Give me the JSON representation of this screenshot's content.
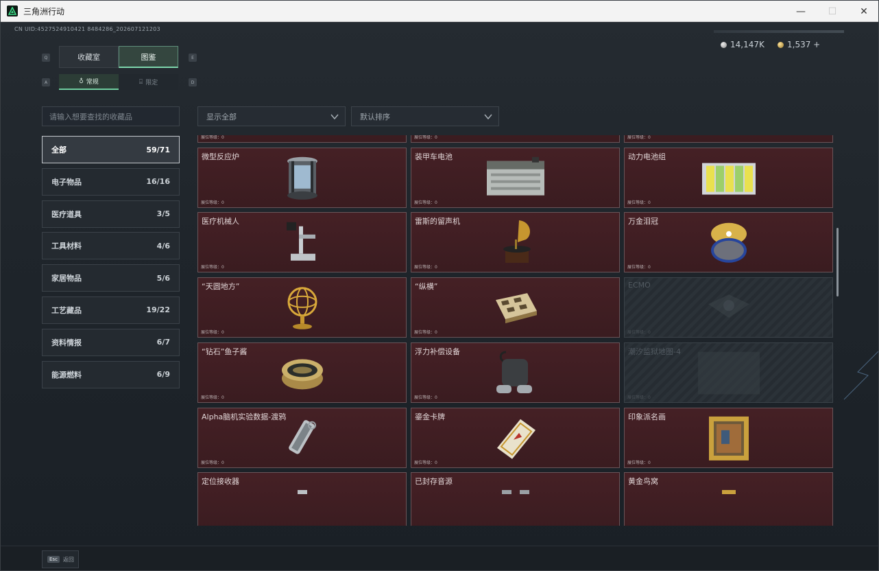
{
  "window": {
    "title": "三角洲行动",
    "minimize": "—",
    "maximize": "☐",
    "close": "✕"
  },
  "uid": "CN UID:4527524910421 8484286_202607121203",
  "currency": [
    {
      "value": "14,147K",
      "color": "#c8c8c8"
    },
    {
      "value": "1,537 +",
      "color": "#d4b35a"
    }
  ],
  "tabs": [
    {
      "label": "收藏室"
    },
    {
      "label": "图鉴"
    }
  ],
  "tab_hints": {
    "left": "Q",
    "right": "E"
  },
  "subtabs": [
    {
      "label": "常规"
    },
    {
      "label": "限定"
    }
  ],
  "subtab_hints": {
    "left": "A",
    "right": "D"
  },
  "search": {
    "placeholder": "请输入想要查找的收藏品"
  },
  "filter": {
    "value": "显示全部"
  },
  "sort": {
    "value": "默认排序"
  },
  "categories": [
    {
      "name": "全部",
      "count": "59/71"
    },
    {
      "name": "电子物品",
      "count": "16/16"
    },
    {
      "name": "医疗道具",
      "count": "3/5"
    },
    {
      "name": "工具材料",
      "count": "4/6"
    },
    {
      "name": "家居物品",
      "count": "5/6"
    },
    {
      "name": "工艺藏品",
      "count": "19/22"
    },
    {
      "name": "资料情报",
      "count": "6/7"
    },
    {
      "name": "能源燃料",
      "count": "6/9"
    }
  ],
  "cards": [
    {
      "name": "",
      "level": "展位等级：0",
      "art": "camera",
      "locked": false
    },
    {
      "name": "",
      "level": "展位等级：0",
      "art": "robot-vacuum",
      "locked": false
    },
    {
      "name": "",
      "level": "展位等级：0",
      "art": "coffee-bag",
      "locked": false
    },
    {
      "name": "微型反应炉",
      "level": "展位等级：0",
      "art": "reactor",
      "locked": false
    },
    {
      "name": "装甲车电池",
      "level": "展位等级：0",
      "art": "battery",
      "locked": false
    },
    {
      "name": "动力电池组",
      "level": "展位等级：0",
      "art": "battery-pack",
      "locked": false
    },
    {
      "name": "医疗机械人",
      "level": "展位等级：0",
      "art": "medical-robot",
      "locked": false
    },
    {
      "name": "雷斯的留声机",
      "level": "展位等级：0",
      "art": "gramophone",
      "locked": false
    },
    {
      "name": "万金泪冠",
      "level": "展位等级：0",
      "art": "egg",
      "locked": false
    },
    {
      "name": "“天圆地方”",
      "level": "展位等级：0",
      "art": "armillary",
      "locked": false
    },
    {
      "name": "“纵横”",
      "level": "展位等级：0",
      "art": "chess",
      "locked": false
    },
    {
      "name": "ECMO",
      "level": "展位等级：0",
      "art": "ecmo",
      "locked": true
    },
    {
      "name": "“钻石”鱼子酱",
      "level": "展位等级：0",
      "art": "caviar",
      "locked": false
    },
    {
      "name": "浮力补偿设备",
      "level": "展位等级：0",
      "art": "bcd",
      "locked": false
    },
    {
      "name": "潮汐监狱地图-4",
      "level": "展位等级：0",
      "art": "map",
      "locked": true
    },
    {
      "name": "Alpha脑机实验数据-渡鸦",
      "level": "展位等级：0",
      "art": "usb",
      "locked": false
    },
    {
      "name": "鎏金卡牌",
      "level": "展位等级：0",
      "art": "card",
      "locked": false
    },
    {
      "name": "印象派名画",
      "level": "展位等级：0",
      "art": "painting",
      "locked": false
    },
    {
      "name": "定位接收器",
      "level": "",
      "art": "receiver",
      "locked": false
    },
    {
      "name": "已封存音源",
      "level": "",
      "art": "audio",
      "locked": false
    },
    {
      "name": "黄金鸟窝",
      "level": "",
      "art": "nest",
      "locked": false
    }
  ],
  "footer": {
    "esc_key": "Esc",
    "esc_label": "返回"
  }
}
